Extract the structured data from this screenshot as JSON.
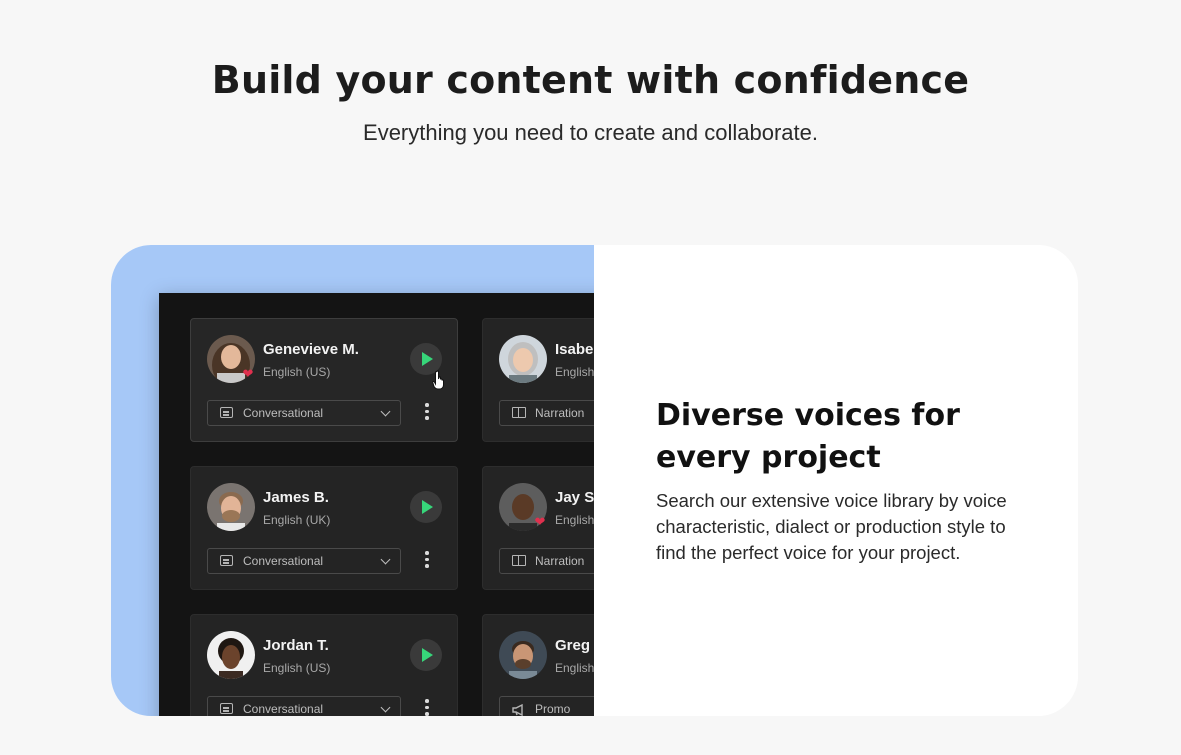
{
  "hero": {
    "title": "Build your content with confidence",
    "subtitle": "Everything you need to create and collaborate."
  },
  "feature": {
    "heading": "Diverse voices for every project",
    "description": "Search our extensive voice library by voice characteristic, dialect or production style to find the perfect voice for your project.",
    "panel_color": "#a6c8f7"
  },
  "voice_cards": [
    {
      "name": "Genevieve M.",
      "language": "English (US)",
      "style": "Conversational",
      "favorite": true
    },
    {
      "name": "Isabel",
      "language": "English",
      "style": "Narration",
      "favorite": false
    },
    {
      "name": "James B.",
      "language": "English (UK)",
      "style": "Conversational",
      "favorite": false
    },
    {
      "name": "Jay S.",
      "language": "English",
      "style": "Narration",
      "favorite": true
    },
    {
      "name": "Jordan T.",
      "language": "English (US)",
      "style": "Conversational",
      "favorite": false
    },
    {
      "name": "Greg G",
      "language": "English",
      "style": "Promo",
      "favorite": false
    }
  ],
  "colors": {
    "play_accent": "#37d67a",
    "favorite_heart": "#e0304e",
    "app_background": "#141414",
    "card_background": "#242424"
  },
  "icons": [
    "play-icon",
    "heart-icon",
    "chat-icon",
    "book-icon",
    "megaphone-icon",
    "chevron-down-icon",
    "more-vertical-icon",
    "hand-cursor-icon"
  ]
}
